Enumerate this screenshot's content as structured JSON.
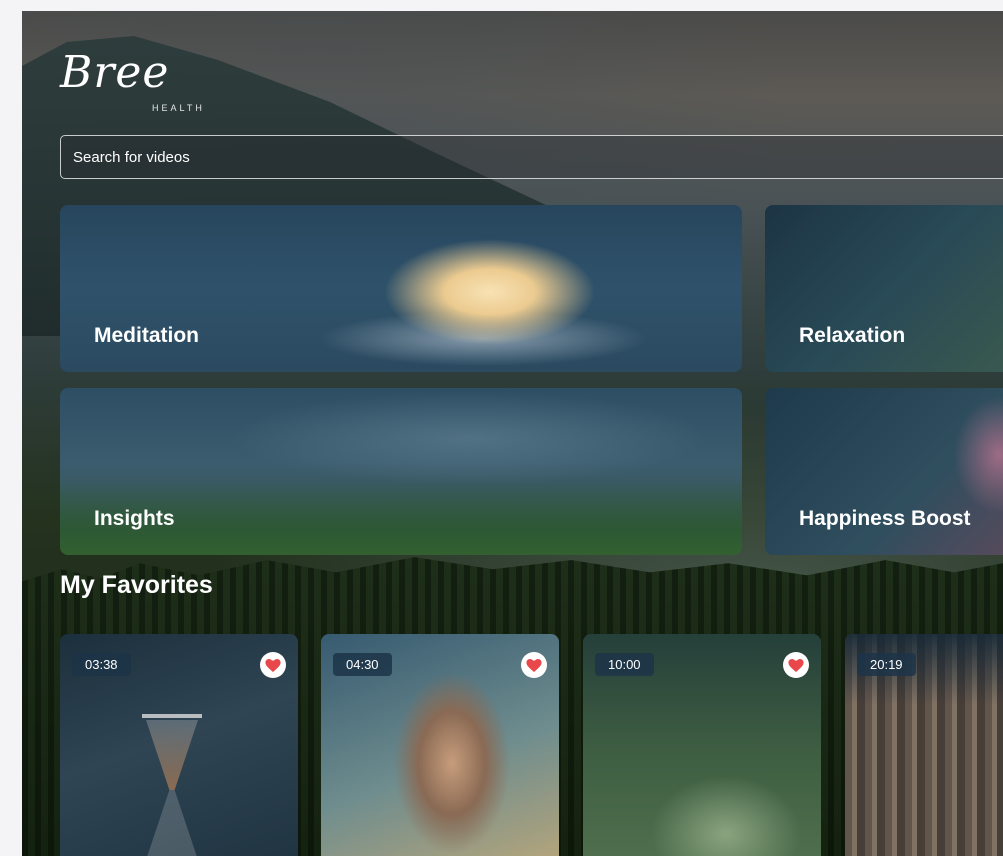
{
  "brand": {
    "logo_word": "Bree",
    "logo_sub": "HEALTH"
  },
  "search": {
    "placeholder": "Search for videos"
  },
  "categories": [
    {
      "label": "Meditation"
    },
    {
      "label": "Relaxation"
    },
    {
      "label": "Insights"
    },
    {
      "label": "Happiness Boost"
    }
  ],
  "favorites": {
    "title": "My Favorites",
    "items": [
      {
        "duration": "03:38",
        "favorited": true
      },
      {
        "duration": "04:30",
        "favorited": true
      },
      {
        "duration": "10:00",
        "favorited": true
      },
      {
        "duration": "20:19",
        "favorited": false
      }
    ]
  },
  "colors": {
    "heart": "#e8484b",
    "badge_bg": "#1c3448",
    "text": "#ffffff"
  }
}
